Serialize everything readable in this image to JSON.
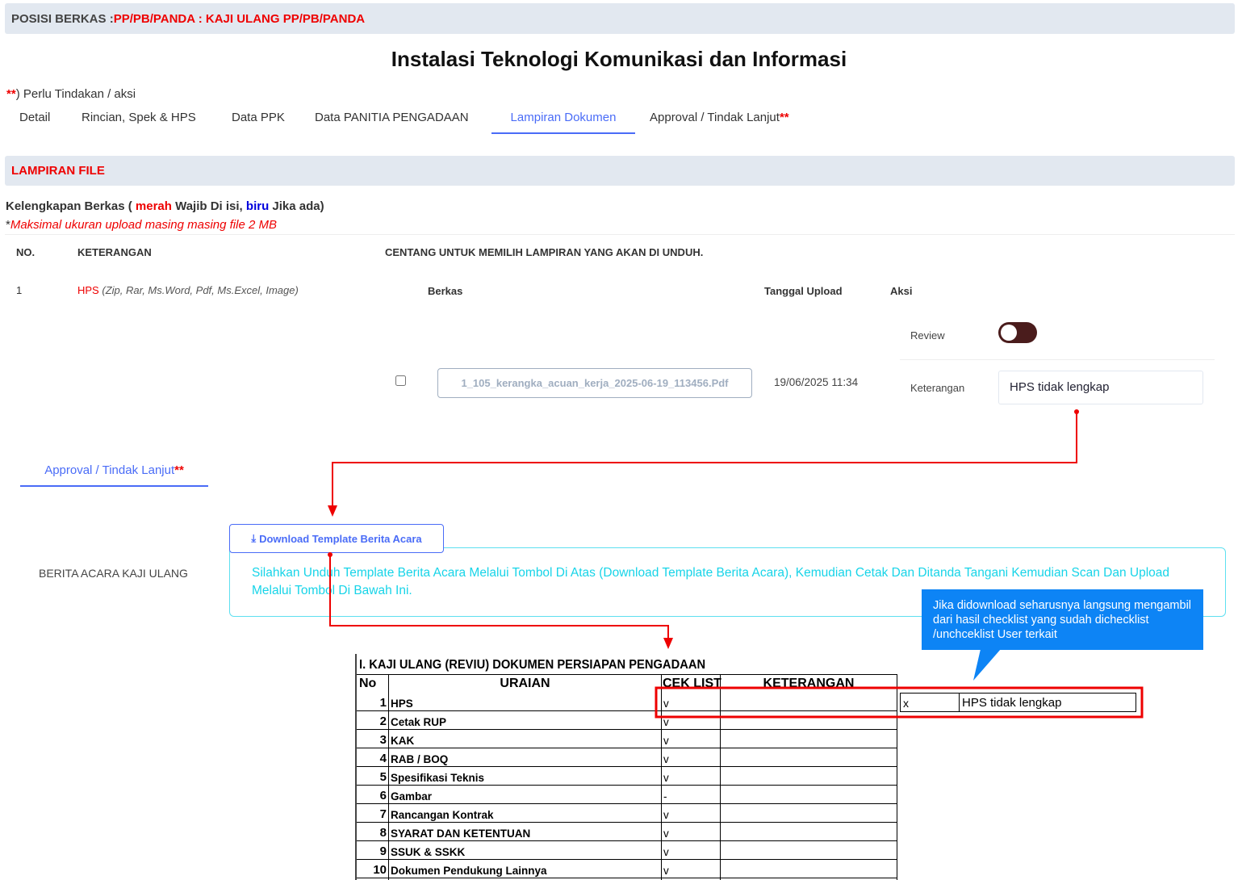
{
  "posisi": {
    "label": "POSISI BERKAS : ",
    "value": "PP/PB/PANDA : KAJI ULANG PP/PB/PANDA"
  },
  "title": "Instalasi Teknologi Komunikasi dan Informasi",
  "note": {
    "stars": "**",
    "text": ") Perlu Tindakan / aksi"
  },
  "tabs": [
    {
      "label": "Detail"
    },
    {
      "label": "Rincian, Spek & HPS"
    },
    {
      "label": "Data PPK"
    },
    {
      "label": "Data PANITIA PENGADAAN"
    },
    {
      "label": "Lampiran Dokumen"
    },
    {
      "label": "Approval / Tindak Lanjut",
      "stars": "**"
    }
  ],
  "section": "LAMPIRAN FILE",
  "kelengkapan": {
    "a": "Kelengkapan Berkas ( ",
    "merah": "merah",
    "b": " Wajib Di isi, ",
    "biru": "biru",
    "c": " Jika ada)"
  },
  "maks": {
    "star": "*",
    "text": "Maksimal ukuran upload masing masing file 2 MB"
  },
  "table_headers": {
    "no": "NO.",
    "ket": "KETERANGAN",
    "centang": "CENTANG UNTUK MEMILIH LAMPIRAN YANG AKAN DI UNDUH."
  },
  "row": {
    "no": "1",
    "name": "HPS",
    "types": "(Zip, Rar, Ms.Word, Pdf, Ms.Excel, Image)",
    "berkas_h": "Berkas",
    "tgl_h": "Tanggal Upload",
    "aksi_h": "Aksi",
    "review": "Review",
    "review_on": true,
    "file": "1_105_kerangka_acuan_kerja_2025-06-19_113456.Pdf",
    "tanggal": "19/06/2025 11:34",
    "keterangan_label": "Keterangan",
    "keterangan_value": "HPS tidak lengkap"
  },
  "approval_tab": {
    "label": "Approval / Tindak Lanjut",
    "stars": "**"
  },
  "berita": {
    "label": "BERITA ACARA KAJI ULANG",
    "button": "Download Template Berita Acara",
    "info": "Silahkan Unduh Template Berita Acara Melalui Tombol Di Atas (Download Template Berita Acara), Kemudian Cetak Dan Ditanda Tangani Kemudian Scan Dan Upload Melalui Tombol Di Bawah Ini."
  },
  "callout": "Jika didownload seharusnya langsung mengambil dari hasil checklist yang sudah dichecklist /unchceklist User terkait",
  "sheet": {
    "title": "I. KAJI ULANG (REVIU) DOKUMEN PERSIAPAN PENGADAAN",
    "headers": [
      "No",
      "URAIAN",
      "CEK LIST",
      "KETERANGAN"
    ],
    "rows": [
      [
        "1",
        "HPS",
        "v"
      ],
      [
        "2",
        "Cetak RUP",
        "v"
      ],
      [
        "3",
        "KAK",
        "v"
      ],
      [
        "4",
        "RAB / BOQ",
        "v"
      ],
      [
        "5",
        "Spesifikasi Teknis",
        "v"
      ],
      [
        "6",
        "Gambar",
        "-"
      ],
      [
        "7",
        "Rancangan Kontrak",
        "v"
      ],
      [
        "8",
        "SYARAT DAN KETENTUAN",
        "v"
      ],
      [
        "9",
        "SSUK & SSKK",
        "v"
      ],
      [
        "10",
        "Dokumen Pendukung Lainnya",
        "v"
      ]
    ],
    "expected": {
      "cek": "x",
      "ket": "HPS tidak lengkap"
    }
  },
  "colors": {
    "accent": "#4a6cf7",
    "red": "#e00",
    "cyan": "#17c1e8",
    "callout": "#0d84f5"
  }
}
